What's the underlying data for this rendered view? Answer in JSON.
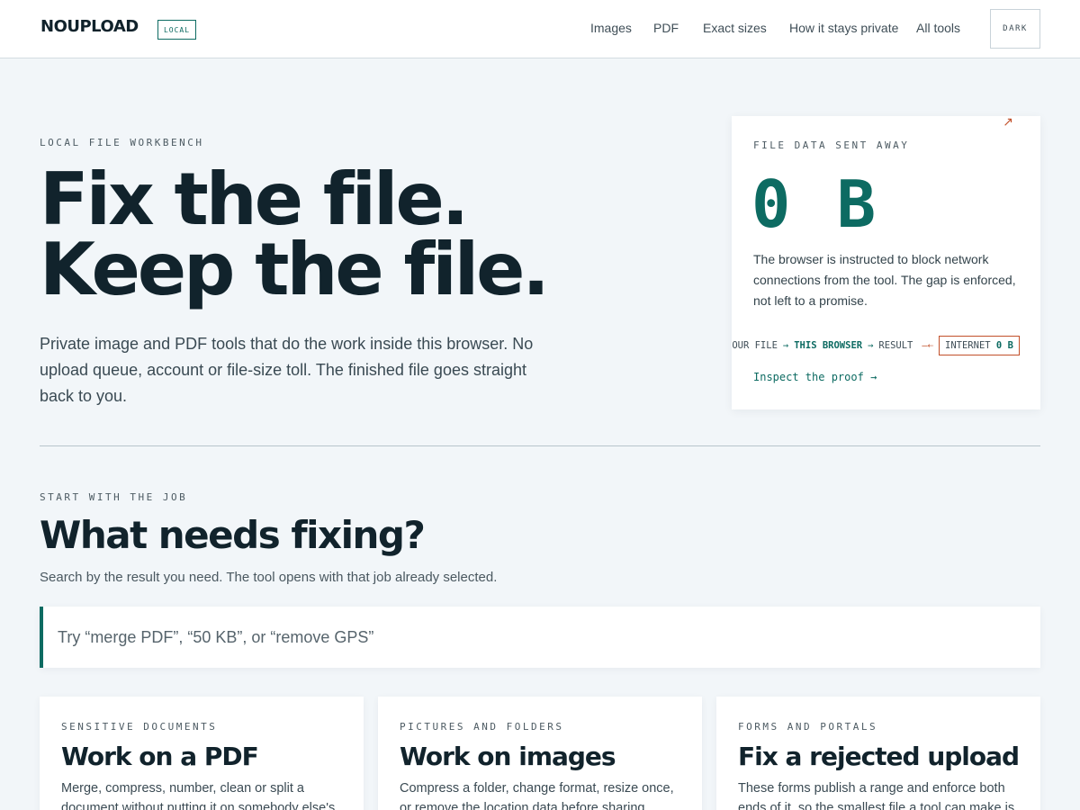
{
  "header": {
    "logo": "NOUPLOAD",
    "badge": "LOCAL",
    "nav": [
      "Images",
      "PDF",
      "Exact sizes",
      "How it stays private",
      "All tools"
    ],
    "theme_button": "DARK"
  },
  "hero": {
    "eyebrow": "LOCAL FILE WORKBENCH",
    "title_line1": "Fix the file.",
    "title_line2": "Keep the file.",
    "description": "Private image and PDF tools that do the work inside this browser. No upload queue, account or file-size toll. The finished file goes straight back to you."
  },
  "proof": {
    "label": "FILE DATA SENT AWAY",
    "value": "0 B",
    "description": "The browser is instructed to block network connections from the tool. The gap is enforced, not left to a promise.",
    "flow": {
      "step1": "YOUR FILE",
      "step2": "THIS BROWSER",
      "step3": "RESULT",
      "internet_label": "INTERNET",
      "internet_value": "0 B"
    },
    "link": "Inspect the proof",
    "link_arrow": "→"
  },
  "search_section": {
    "eyebrow": "START WITH THE JOB",
    "title": "What needs fixing?",
    "subtitle": "Search by the result you need. The tool opens with that job already selected.",
    "placeholder": "Try “merge PDF”, “50 KB”, or “remove GPS”"
  },
  "cards": [
    {
      "kicker": "SENSITIVE DOCUMENTS",
      "title": "Work on a PDF",
      "description": "Merge, compress, number, clean or split a document without putting it on somebody else's"
    },
    {
      "kicker": "PICTURES AND FOLDERS",
      "title": "Work on images",
      "description": "Compress a folder, change format, resize once, or remove the location data before sharing."
    },
    {
      "kicker": "FORMS AND PORTALS",
      "title": "Fix a rejected upload",
      "description": "These forms publish a range and enforce both ends of it, so the smallest file a tool can make is"
    }
  ],
  "colors": {
    "accent": "#0d6b62",
    "warning": "#c2502a",
    "background": "#f2f6f9"
  }
}
